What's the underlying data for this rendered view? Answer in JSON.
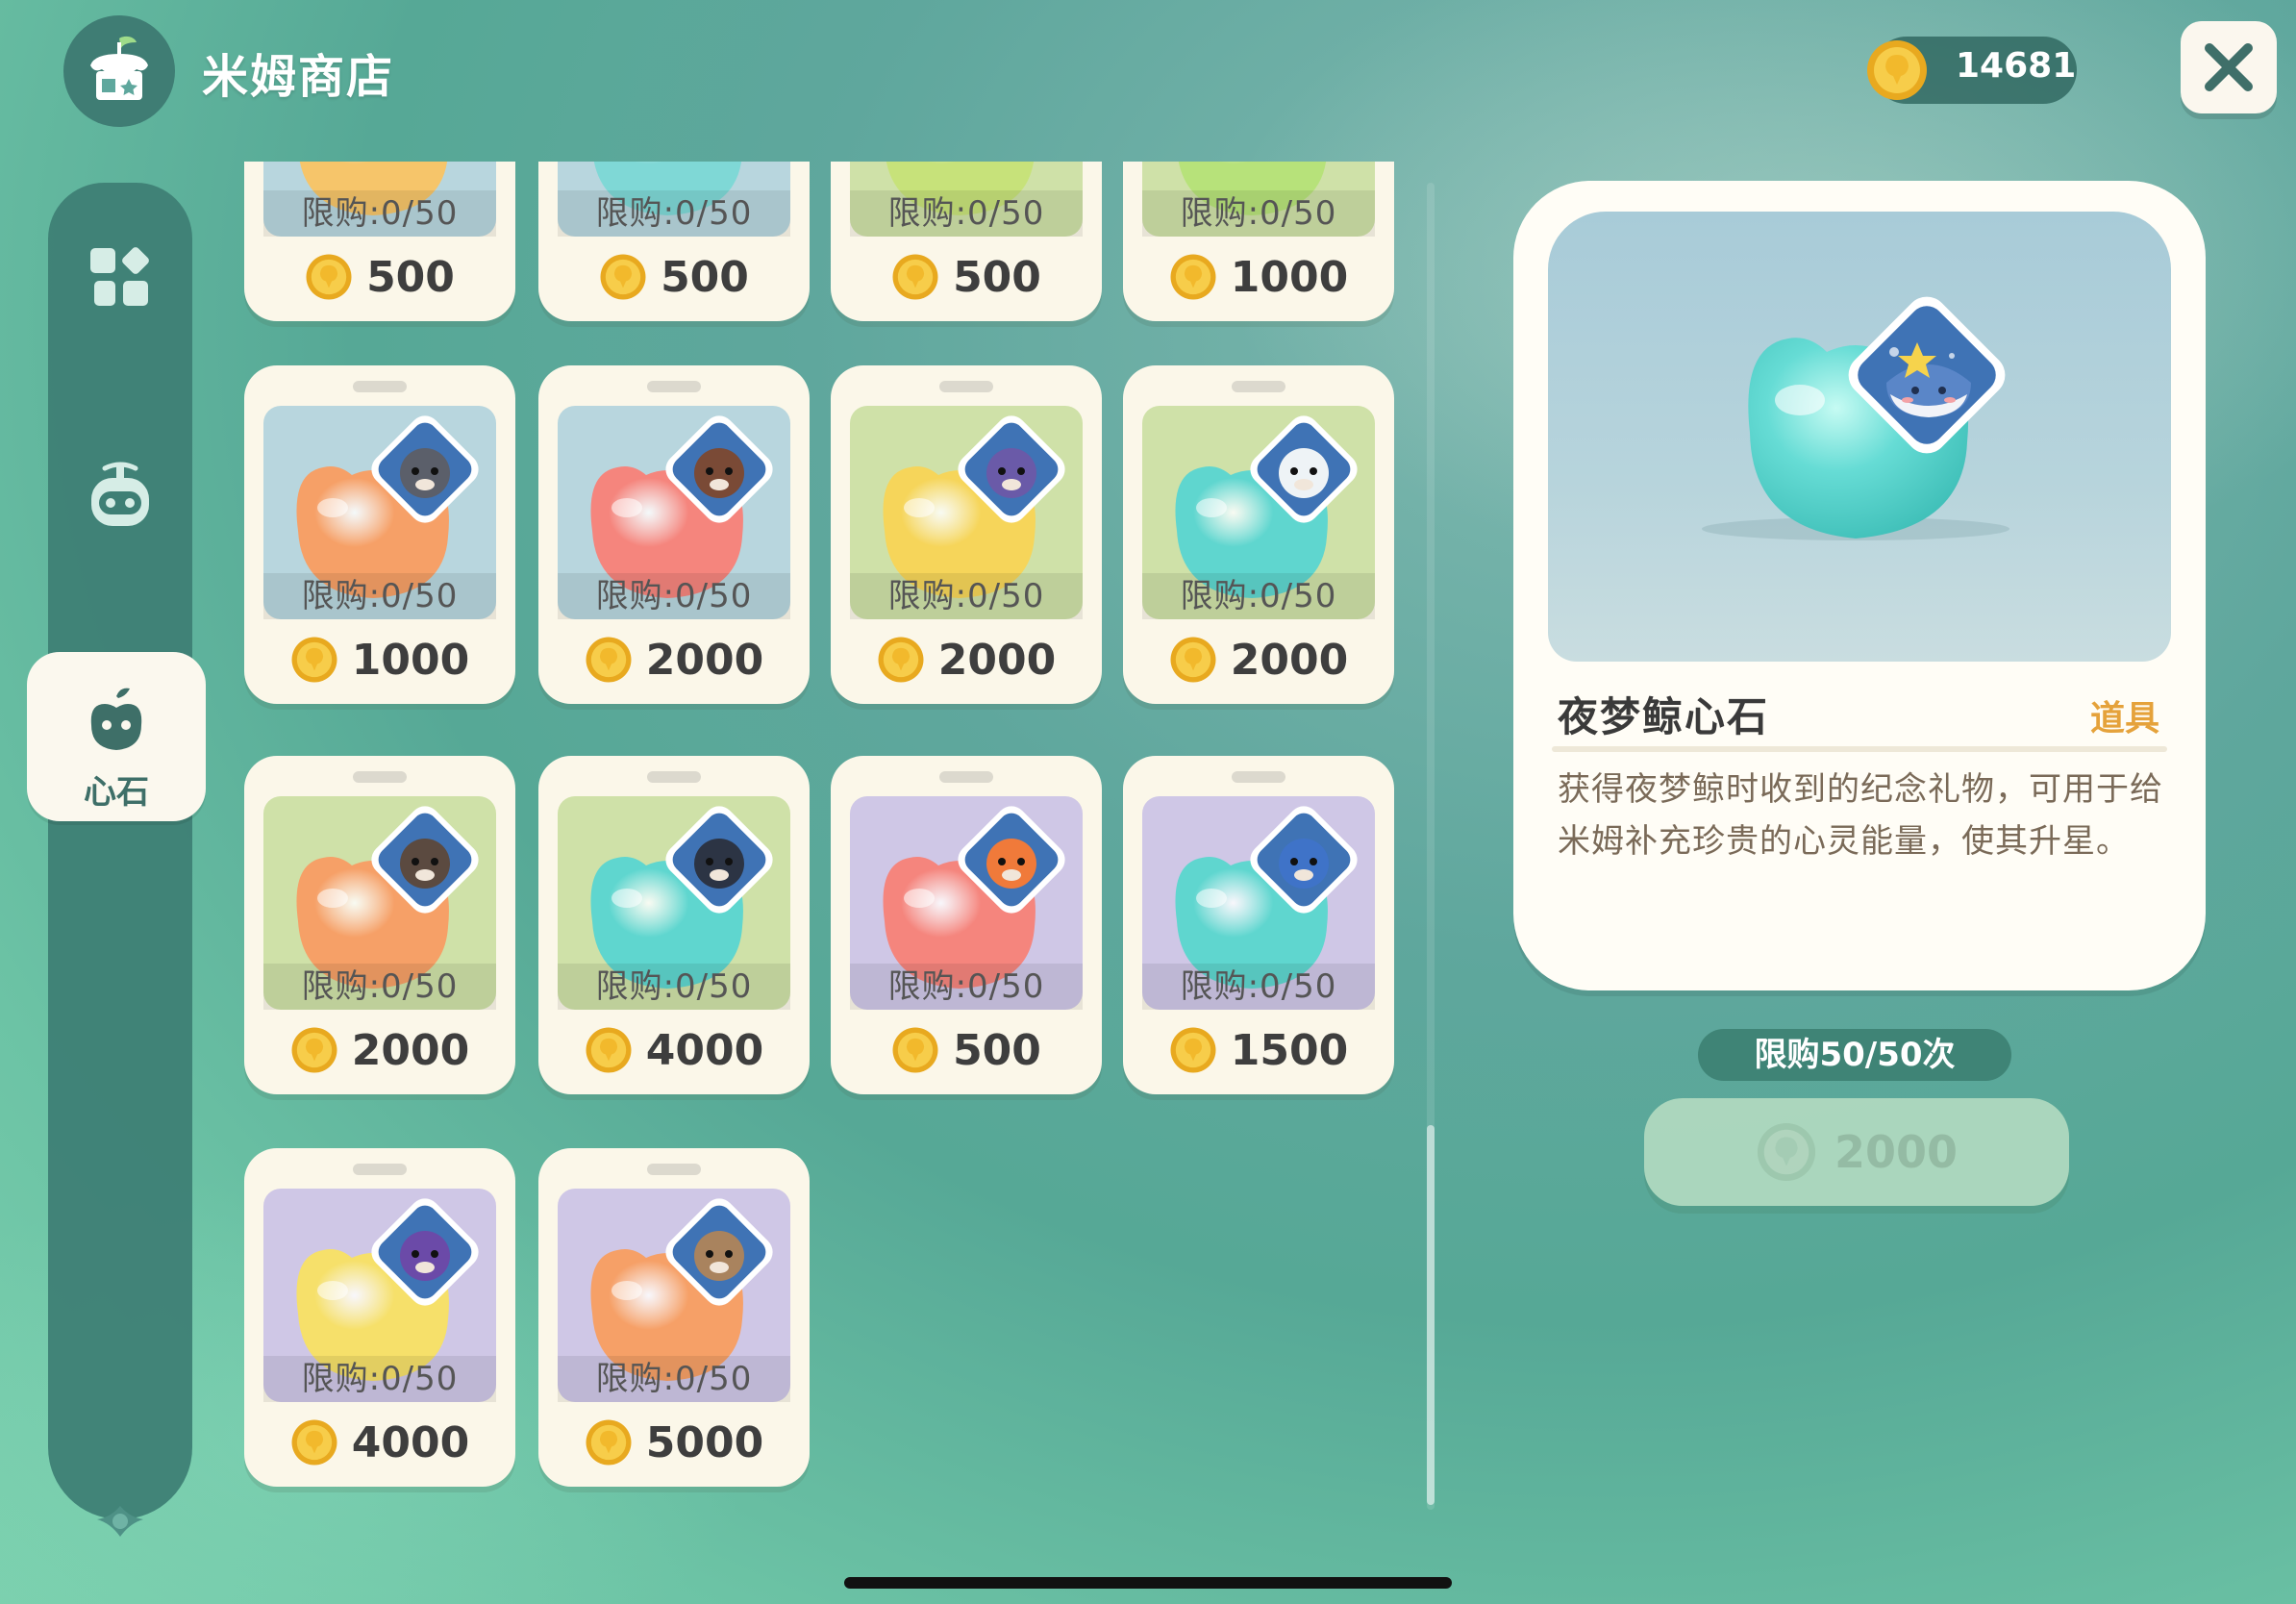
{
  "header": {
    "title": "米姆商店",
    "coins": "14681"
  },
  "sidebar": {
    "items": [
      {
        "icon": "grid-icon"
      },
      {
        "icon": "robot-icon"
      },
      {
        "icon": "heart-stone-icon",
        "label": "心石",
        "active": true
      }
    ]
  },
  "grid": {
    "cards": [
      {
        "limit": "限购:0/50",
        "price": "500",
        "bg": "#b8d6de",
        "slime": "#f6c56a",
        "badge": ""
      },
      {
        "limit": "限购:0/50",
        "price": "500",
        "bg": "#b8d6de",
        "slime": "#7fd8d6",
        "badge": ""
      },
      {
        "limit": "限购:0/50",
        "price": "500",
        "bg": "#cfe1a8",
        "slime": "#c7e27a",
        "badge": ""
      },
      {
        "limit": "限购:0/50",
        "price": "1000",
        "bg": "#cfe1a8",
        "slime": "#b7e27a",
        "badge": ""
      },
      {
        "limit": "限购:0/50",
        "price": "1000",
        "bg": "#b8d6de",
        "slime": "#f6a067",
        "badge": "raccoon"
      },
      {
        "limit": "限购:0/50",
        "price": "2000",
        "bg": "#b8d6de",
        "slime": "#f5857d",
        "badge": "monkey"
      },
      {
        "limit": "限购:0/50",
        "price": "2000",
        "bg": "#cfe1a8",
        "slime": "#f6d55a",
        "badge": "owl"
      },
      {
        "limit": "限购:0/50",
        "price": "2000",
        "bg": "#cfe1a8",
        "slime": "#5fd6cf",
        "badge": "sheep"
      },
      {
        "limit": "限购:0/50",
        "price": "2000",
        "bg": "#cfe1a8",
        "slime": "#f6a067",
        "badge": "otter"
      },
      {
        "limit": "限购:0/50",
        "price": "4000",
        "bg": "#cfe1a8",
        "slime": "#5fd6cf",
        "badge": "orca"
      },
      {
        "limit": "限购:0/50",
        "price": "500",
        "bg": "#cfc7e6",
        "slime": "#f5857d",
        "badge": "fox"
      },
      {
        "limit": "限购:0/50",
        "price": "1500",
        "bg": "#cfc7e6",
        "slime": "#5fd6cf",
        "badge": "whale"
      },
      {
        "limit": "限购:0/50",
        "price": "4000",
        "bg": "#cfc7e6",
        "slime": "#f6e06a",
        "badge": "cat"
      },
      {
        "limit": "限购:0/50",
        "price": "5000",
        "bg": "#cfc7e6",
        "slime": "#f6a067",
        "badge": "deer"
      }
    ]
  },
  "detail": {
    "name": "夜梦鲸心石",
    "type": "道具",
    "description": "获得夜梦鲸时收到的纪念礼物，可用于给米姆补充珍贵的心灵能量，使其升星。",
    "purchase_limit": "限购50/50次",
    "buy_price": "2000"
  },
  "colors": {
    "accent": "#3f8476",
    "coin": "#f2b92c",
    "card": "#fbf7e9",
    "tag": "#e5a23b"
  }
}
